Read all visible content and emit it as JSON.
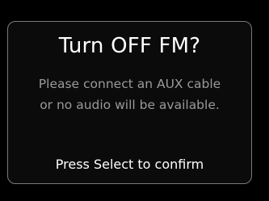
{
  "dialog": {
    "title": "Turn OFF FM?",
    "message_line1": "Please connect an AUX cable",
    "message_line2": "or no audio will be available.",
    "confirm_text": "Press Select to confirm"
  },
  "colors": {
    "background": "#000000",
    "border": "#7a7a7a",
    "title": "#ffffff",
    "message": "#9a9a9a"
  }
}
